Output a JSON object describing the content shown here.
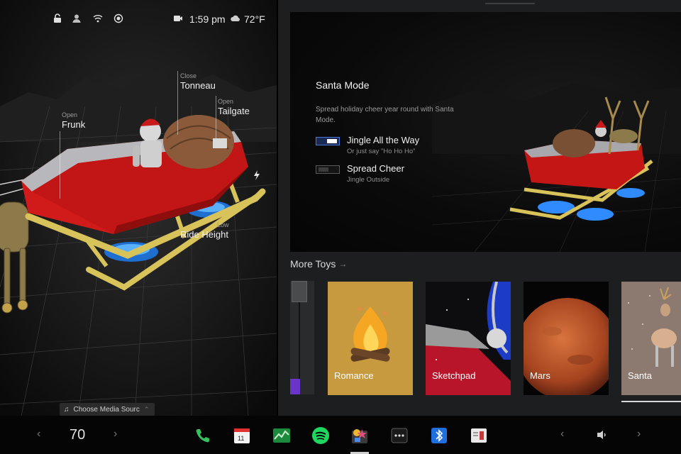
{
  "status": {
    "time": "1:59 pm",
    "temperature": "72°F",
    "icons": [
      "lock-icon",
      "user-icon",
      "wifi-icon",
      "record-icon",
      "camera-icon",
      "cloud-icon"
    ]
  },
  "car": {
    "callouts": {
      "frunk": {
        "state": "Open",
        "label": "Frunk"
      },
      "tonneau": {
        "state": "Close",
        "label": "Tonneau"
      },
      "tailgate": {
        "state": "Open",
        "label": "Tailgate"
      },
      "ride_height": {
        "state": "Low",
        "label": "Ride Height"
      }
    },
    "media_source": "Choose Media Sourc"
  },
  "toy_panel": {
    "title": "Santa Mode",
    "description": "Spread holiday cheer year round with Santa Mode.",
    "options": [
      {
        "label": "Jingle All the Way",
        "sub": "Or just say \"Ho Ho Ho\"",
        "enabled": true
      },
      {
        "label": "Spread Cheer",
        "sub": "Jingle Outside",
        "enabled": false
      }
    ],
    "more_toys": "More Toys",
    "toys": [
      {
        "name": "Romance"
      },
      {
        "name": "Sketchpad"
      },
      {
        "name": "Mars"
      },
      {
        "name": "Santa",
        "selected": true
      }
    ]
  },
  "dock": {
    "temperature": "70",
    "calendar_day": "11",
    "apps": [
      "phone-icon",
      "calendar-icon",
      "energy-icon",
      "spotify-icon",
      "toybox-icon",
      "more-icon",
      "bluetooth-icon",
      "dashcam-icon"
    ],
    "volume_icon": "volume-icon"
  },
  "colors": {
    "accent": "#4b78d8",
    "scroll_fill": "#6a34c8",
    "phone": "#37c15b",
    "spotify": "#1ed760",
    "bluetooth": "#1f6fe0"
  }
}
